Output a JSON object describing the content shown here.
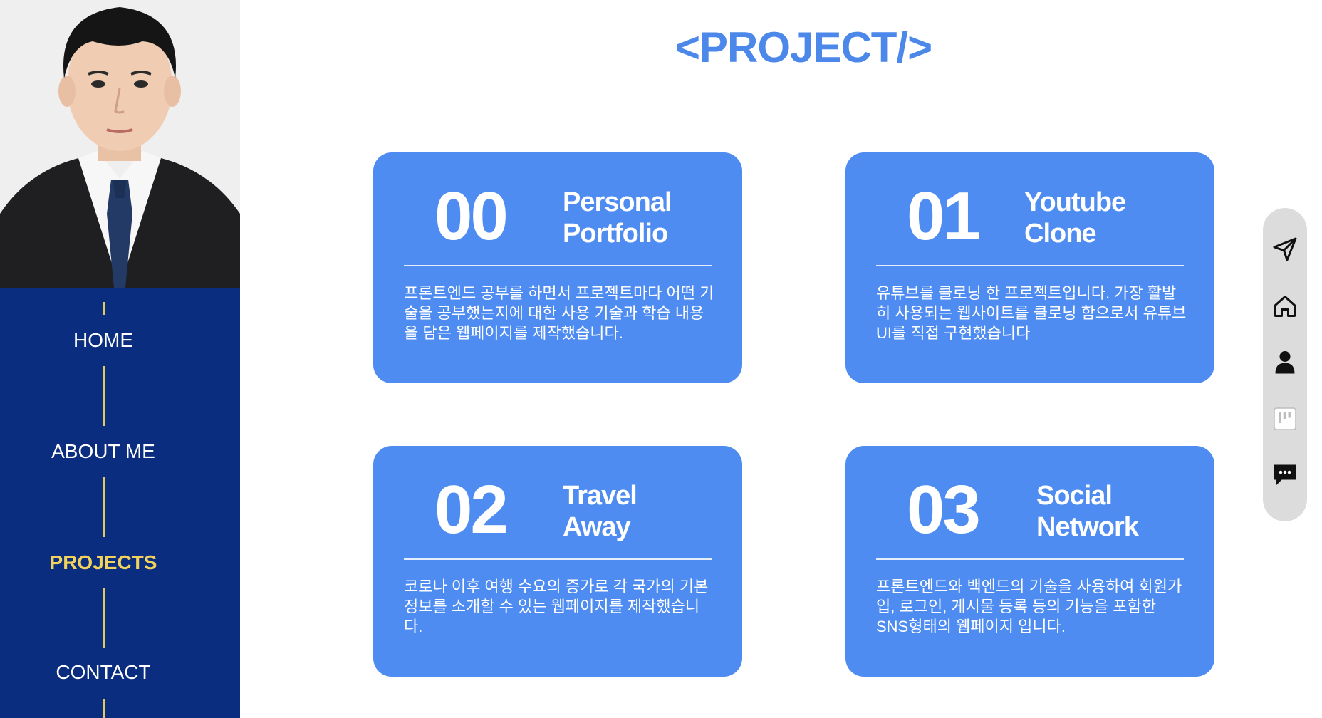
{
  "title": "<PROJECT/>",
  "nav": {
    "items": [
      {
        "label": "HOME"
      },
      {
        "label": "ABOUT ME"
      },
      {
        "label": "PROJECTS"
      },
      {
        "label": "CONTACT"
      }
    ],
    "active": "PROJECTS"
  },
  "projects": [
    {
      "number": "00",
      "name_line1": "Personal",
      "name_line2": "Portfolio",
      "description": "프론트엔드 공부를 하면서 프로젝트마다 어떤 기술을 공부했는지에 대한 사용 기술과 학습 내용을 담은 웹페이지를 제작했습니다."
    },
    {
      "number": "01",
      "name_line1": "Youtube",
      "name_line2": "Clone",
      "description": "유튜브를 클로닝 한 프로젝트입니다. 가장 활발히 사용되는 웹사이트를 클로닝 함으로서 유튜브 UI를 직접 구현했습니다"
    },
    {
      "number": "02",
      "name_line1": "Travel",
      "name_line2": "Away",
      "description": "코로나 이후 여행 수요의 증가로 각 국가의 기본 정보를 소개할 수 있는 웹페이지를 제작했습니다."
    },
    {
      "number": "03",
      "name_line1": "Social",
      "name_line2": "Network",
      "description": "프론트엔드와 백엔드의 기술을 사용하여 회원가입, 로그인, 게시물 등록 등의 기능을 포함한 SNS형태의 웹페이지 입니다."
    }
  ],
  "floatbar": {
    "icons": [
      "send-icon",
      "home-icon",
      "user-icon",
      "notion-icon",
      "chat-icon"
    ]
  },
  "colors": {
    "sidebar": "#0b2d80",
    "accent_yellow": "#f1d25d",
    "card_blue": "#4f8cf2",
    "title_blue": "#4c87ea"
  }
}
